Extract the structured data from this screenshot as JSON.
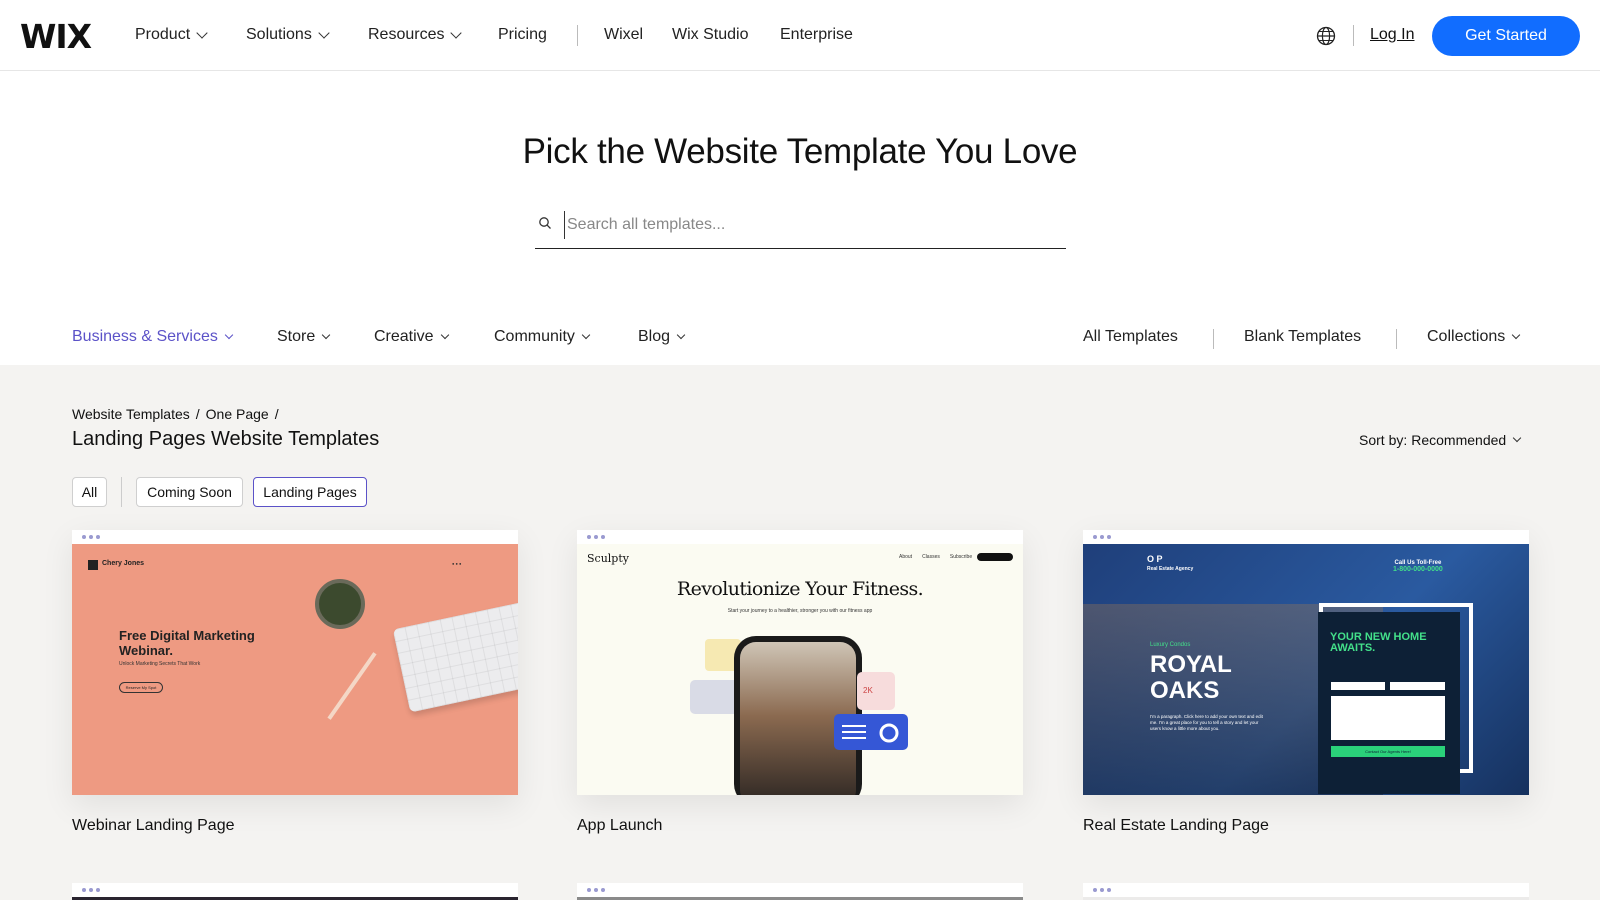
{
  "header": {
    "logo": "WIX",
    "nav": [
      {
        "label": "Product",
        "dropdown": true
      },
      {
        "label": "Solutions",
        "dropdown": true
      },
      {
        "label": "Resources",
        "dropdown": true
      },
      {
        "label": "Pricing",
        "dropdown": false
      },
      {
        "label": "Wixel",
        "dropdown": false
      },
      {
        "label": "Wix Studio",
        "dropdown": false
      },
      {
        "label": "Enterprise",
        "dropdown": false
      }
    ],
    "language_icon": "globe-icon",
    "login": "Log In",
    "cta": "Get Started",
    "cta_color": "#116dff"
  },
  "hero": {
    "title": "Pick the Website Template You Love",
    "search_placeholder": "Search all templates..."
  },
  "categories": {
    "left": [
      {
        "label": "Business & Services",
        "active": true
      },
      {
        "label": "Store",
        "active": false
      },
      {
        "label": "Creative",
        "active": false
      },
      {
        "label": "Community",
        "active": false
      },
      {
        "label": "Blog",
        "active": false
      }
    ],
    "right": [
      {
        "label": "All Templates",
        "dropdown": false
      },
      {
        "label": "Blank Templates",
        "dropdown": false
      },
      {
        "label": "Collections",
        "dropdown": true
      }
    ],
    "active_color": "#5b52c8"
  },
  "breadcrumb": [
    "Website Templates",
    "/",
    "One Page",
    "/"
  ],
  "page_title": "Landing Pages Website Templates",
  "sort": {
    "label": "Sort by:",
    "value": "Recommended"
  },
  "filters": [
    "All",
    "Coming Soon",
    "Landing Pages"
  ],
  "active_filter": "Landing Pages",
  "templates": [
    {
      "title": "Webinar Landing Page",
      "preview": {
        "brand": "Chery Jones",
        "headline": "Free Digital Marketing Webinar.",
        "sub": "Unlock Marketing Secrets That Work",
        "button": "Reserve My Spot"
      }
    },
    {
      "title": "App Launch",
      "preview": {
        "brand": "Sculpty",
        "nav": [
          "About",
          "Classes",
          "Subscribe"
        ],
        "headline": "Revolutionize Your Fitness.",
        "sub": "Start your journey to a healthier, stronger you with our fitness app",
        "stat": "2K"
      }
    },
    {
      "title": "Real Estate Landing Page",
      "preview": {
        "logo": "O P",
        "agency": "Real Estate Agency",
        "call": "Call Us Toll-Free",
        "phone": "1-800-000-0000",
        "eyebrow": "Luxury Condos",
        "headline": "ROYAL OAKS",
        "form_title": "YOUR NEW HOME AWAITS.",
        "para": "I'm a paragraph. Click here to add your own text and edit me. I'm a great place for you to tell a story and let your users know a little more about you.",
        "submit": "Contact Our Agents Here!"
      }
    }
  ]
}
